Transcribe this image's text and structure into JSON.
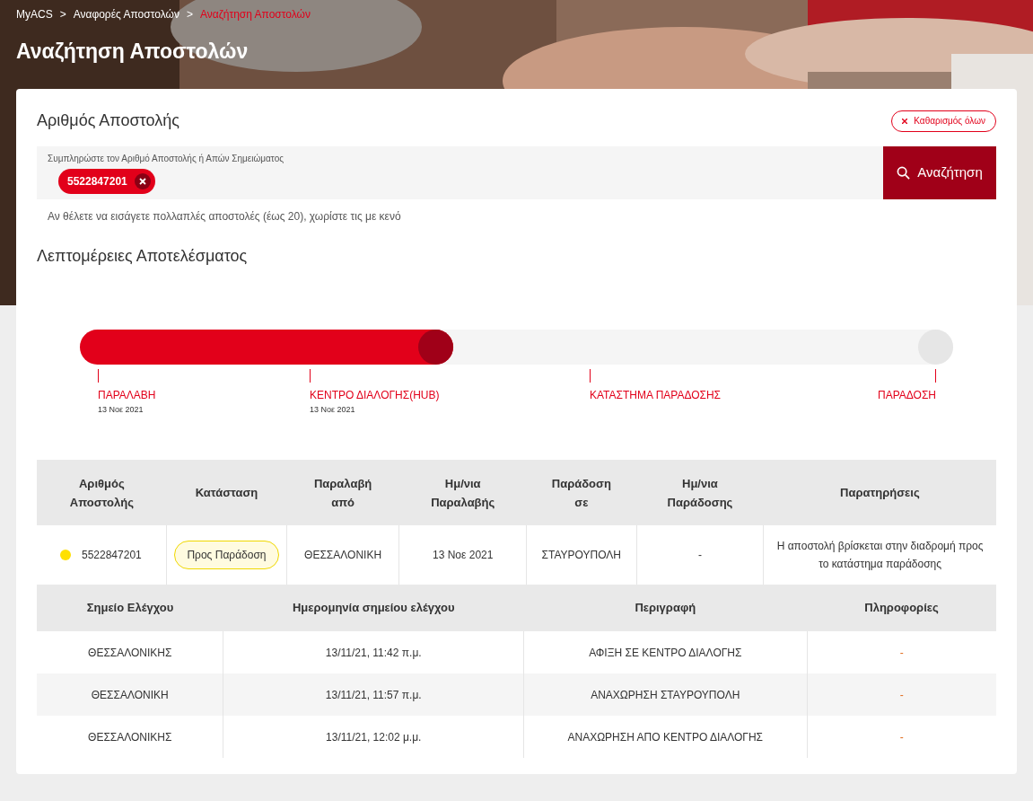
{
  "breadcrumb": [
    {
      "label": "MyACS",
      "current": false
    },
    {
      "label": "Αναφορές Αποστολών",
      "current": false
    },
    {
      "label": "Αναζήτηση Αποστολών",
      "current": true
    }
  ],
  "breadcrumb_separator": ">",
  "page_title": "Αναζήτηση Αποστολών",
  "search": {
    "heading": "Αριθμός Αποστολής",
    "clear_all": "Καθαρισμός όλων",
    "field_label": "Συμπληρώστε τον Αριθμό Αποστολής ή Απών Σημειώματος",
    "tags": [
      "5522847201"
    ],
    "button": "Αναζήτηση",
    "hint": "Αν θέλετε να εισάγετε πολλαπλές αποστολές (έως 20), χωρίστε τις με κενό"
  },
  "results": {
    "heading": "Λεπτομέρειες Αποτελέσματος",
    "progress": {
      "level": 0.43,
      "milestones": [
        {
          "label": "ΠΑΡΑΛΑΒΗ",
          "date": "13 Νοε 2021"
        },
        {
          "label": "ΚΕΝΤΡΟ ΔΙΑΛΟΓΗΣ(HUB)",
          "date": "13 Νοε 2021"
        },
        {
          "label": "ΚΑΤΑΣΤΗΜΑ ΠΑΡΑΔΟΣΗΣ"
        },
        {
          "label": "ΠΑΡΑΔΟΣΗ"
        }
      ]
    },
    "table": {
      "columns": [
        "Αριθμός Αποστολής",
        "Κατάσταση",
        "Παραλαβή από",
        "Ημ/νια Παραλαβής",
        "Παράδοση σε",
        "Ημ/νια Παράδοσης",
        "Παρατηρήσεις"
      ],
      "rows": [
        {
          "color": "#ffe000",
          "number": "5522847201",
          "status": "Προς Παράδοση",
          "pickup_from": "ΘΕΣΣΑΛΟΝΙΚΗ",
          "pickup_date": "13 Νοε 2021",
          "delivery_to": "ΣΤΑΥΡΟΥΠΟΛΗ",
          "delivery_date": "-",
          "remarks": "Η αποστολή βρίσκεται στην διαδρομή προς το κατάστημα παράδοσης"
        }
      ]
    },
    "checkpoints": {
      "columns": [
        "Σημείο Ελέγχου",
        "Ημερομηνία σημείου ελέγχου",
        "Περιγραφή",
        "Πληροφορίες"
      ],
      "rows": [
        {
          "point": "ΘΕΣΣΑΛΟΝΙΚΗΣ",
          "date": "13/11/21, 11:42 π.μ.",
          "description": "ΑΦΙΞΗ ΣΕ ΚΕΝΤΡΟ ΔΙΑΛΟΓΗΣ",
          "info": "-"
        },
        {
          "point": "ΘΕΣΣΑΛΟΝΙΚΗ",
          "date": "13/11/21, 11:57 π.μ.",
          "description": "ΑΝΑΧΩΡΗΣΗ ΣΤΑΥΡΟΥΠΟΛΗ",
          "info": "-"
        },
        {
          "point": "ΘΕΣΣΑΛΟΝΙΚΗΣ",
          "date": "13/11/21, 12:02 μ.μ.",
          "description": "ΑΝΑΧΩΡΗΣΗ ΑΠΟ ΚΕΝΤΡΟ ΔΙΑΛΟΓΗΣ",
          "info": "-"
        }
      ]
    }
  }
}
